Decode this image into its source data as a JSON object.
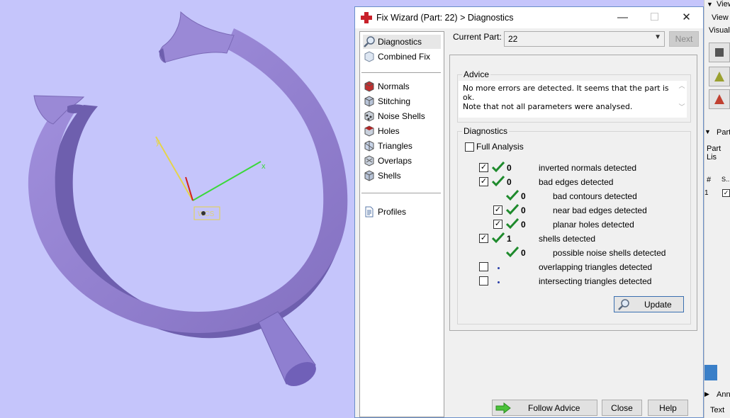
{
  "dialog": {
    "title": "Fix Wizard (Part: 22) > Diagnostics",
    "min_glyph": "—",
    "max_glyph": "☐",
    "close_glyph": "✕",
    "nav": {
      "top": [
        "Diagnostics",
        "Combined Fix"
      ],
      "fixes": [
        "Normals",
        "Stitching",
        "Noise Shells",
        "Holes",
        "Triangles",
        "Overlaps",
        "Shells"
      ],
      "bottom": [
        "Profiles"
      ]
    },
    "current_part_label": "Current Part:",
    "current_part_value": "22",
    "next_label": "Next",
    "advice_title": "Advice",
    "advice_line1": "No more errors are detected. It seems that the part is ok.",
    "advice_line2": "Note that not all parameters were analysed.",
    "diagnostics_title": "Diagnostics",
    "full_analysis_label": "Full Analysis",
    "rows": [
      {
        "text": "inverted normals detected",
        "count": "0"
      },
      {
        "text": "bad edges detected",
        "count": "0"
      },
      {
        "text": "bad contours detected",
        "count": "0"
      },
      {
        "text": "near bad edges detected",
        "count": "0"
      },
      {
        "text": "planar holes detected",
        "count": "0"
      },
      {
        "text": "shells detected",
        "count": "1"
      },
      {
        "text": "possible noise shells detected",
        "count": "0"
      },
      {
        "text": "overlapping triangles detected",
        "count": ""
      },
      {
        "text": "intersecting triangles detected",
        "count": ""
      }
    ],
    "update_label": "Update",
    "follow_advice_label": "Follow Advice",
    "close_label": "Close",
    "help_label": "Help"
  },
  "viewport": {
    "axis_x": "x",
    "axis_y": "y",
    "axis_z": "z",
    "origin_label": "WCS",
    "model_color": "#9b8ad6",
    "background_color": "#c5c5fb"
  },
  "right_panel": {
    "view_label": "View",
    "view_item": "View",
    "visual_label": "Visuali:",
    "part_label": "Part",
    "part_list_label": "Part Lis",
    "col_hash": "#",
    "col_s": "S...",
    "row_num": "1",
    "annot_label": "Ann",
    "text_label": "Text"
  }
}
